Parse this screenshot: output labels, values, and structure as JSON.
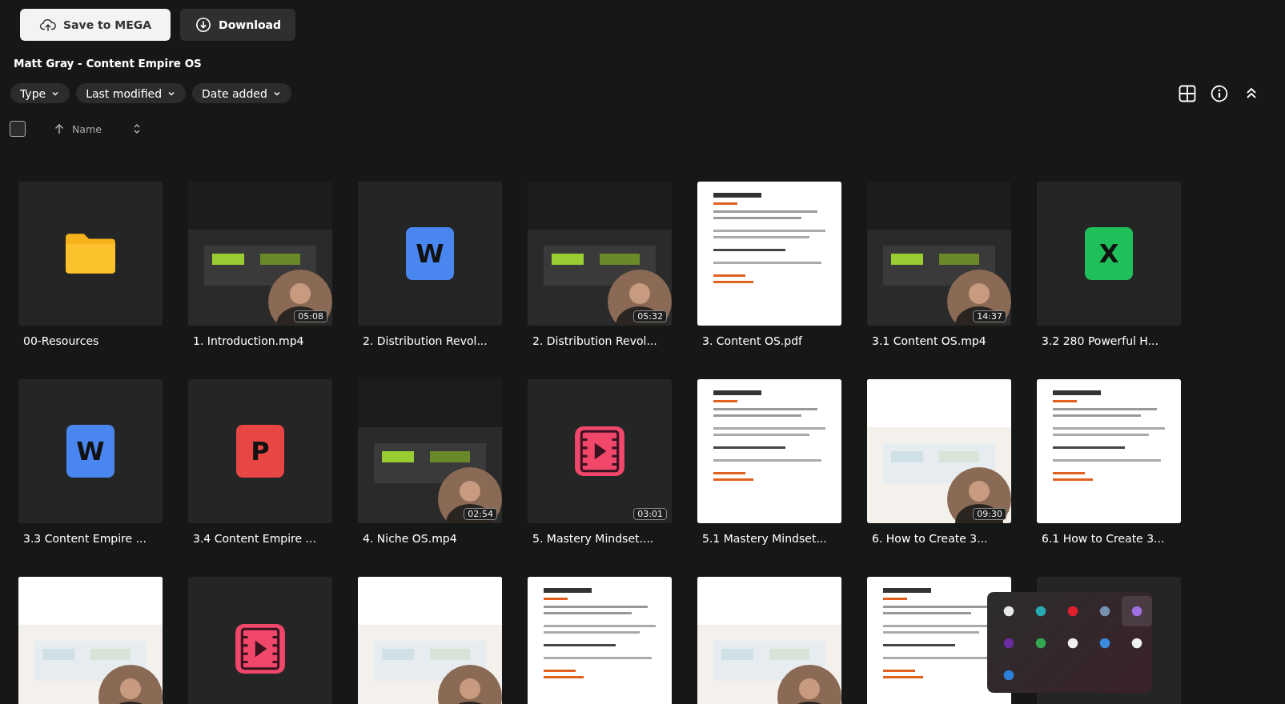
{
  "actions": [
    {
      "kind": "save",
      "label": "Save to MEGA"
    },
    {
      "kind": "download",
      "label": "Download"
    }
  ],
  "folder_title": "Matt Gray - Content Empire OS",
  "filters": [
    "Type",
    "Last modified",
    "Date added"
  ],
  "sort": {
    "label": "Name",
    "select_all_checked": false
  },
  "files": [
    {
      "kind": "folder",
      "name": "00-Resources"
    },
    {
      "kind": "video",
      "name": "1. Introduction.mp4",
      "duration": "05:08"
    },
    {
      "kind": "word",
      "name": "2. Distribution Revol...",
      "badge_letter": "W"
    },
    {
      "kind": "video",
      "name": "2. Distribution Revol...",
      "duration": "05:32"
    },
    {
      "kind": "document",
      "name": "3. Content OS.pdf"
    },
    {
      "kind": "video",
      "name": "3.1 Content OS.mp4",
      "duration": "14:37"
    },
    {
      "kind": "excel",
      "name": "3.2 280 Powerful H...",
      "badge_letter": "X"
    },
    {
      "kind": "word",
      "name": "3.3 Content Empire ...",
      "badge_letter": "W"
    },
    {
      "kind": "powerpoint",
      "name": "3.4 Content Empire ...",
      "badge_letter": "P"
    },
    {
      "kind": "video",
      "name": "4. Niche OS.mp4",
      "duration": "02:54"
    },
    {
      "kind": "videofile",
      "name": "5. Mastery Mindset....",
      "duration": "03:01"
    },
    {
      "kind": "document",
      "name": "5.1 Mastery Mindset..."
    },
    {
      "kind": "video",
      "name": "6. How to Create 3...",
      "duration": "09:30"
    },
    {
      "kind": "document",
      "name": "6.1 How to Create 3..."
    },
    {
      "kind": "video"
    },
    {
      "kind": "videofile"
    },
    {
      "kind": "video"
    },
    {
      "kind": "document"
    },
    {
      "kind": "video"
    },
    {
      "kind": "document"
    },
    {
      "kind": "blank"
    }
  ],
  "tray": {
    "icons": [
      {
        "selected": false
      },
      {
        "selected": false
      },
      {
        "selected": false
      },
      {
        "selected": false
      },
      {
        "selected": true
      },
      {
        "selected": false
      },
      {
        "selected": false
      },
      {
        "selected": false
      },
      {
        "selected": false
      },
      {
        "selected": false
      },
      {
        "selected": false
      }
    ]
  }
}
